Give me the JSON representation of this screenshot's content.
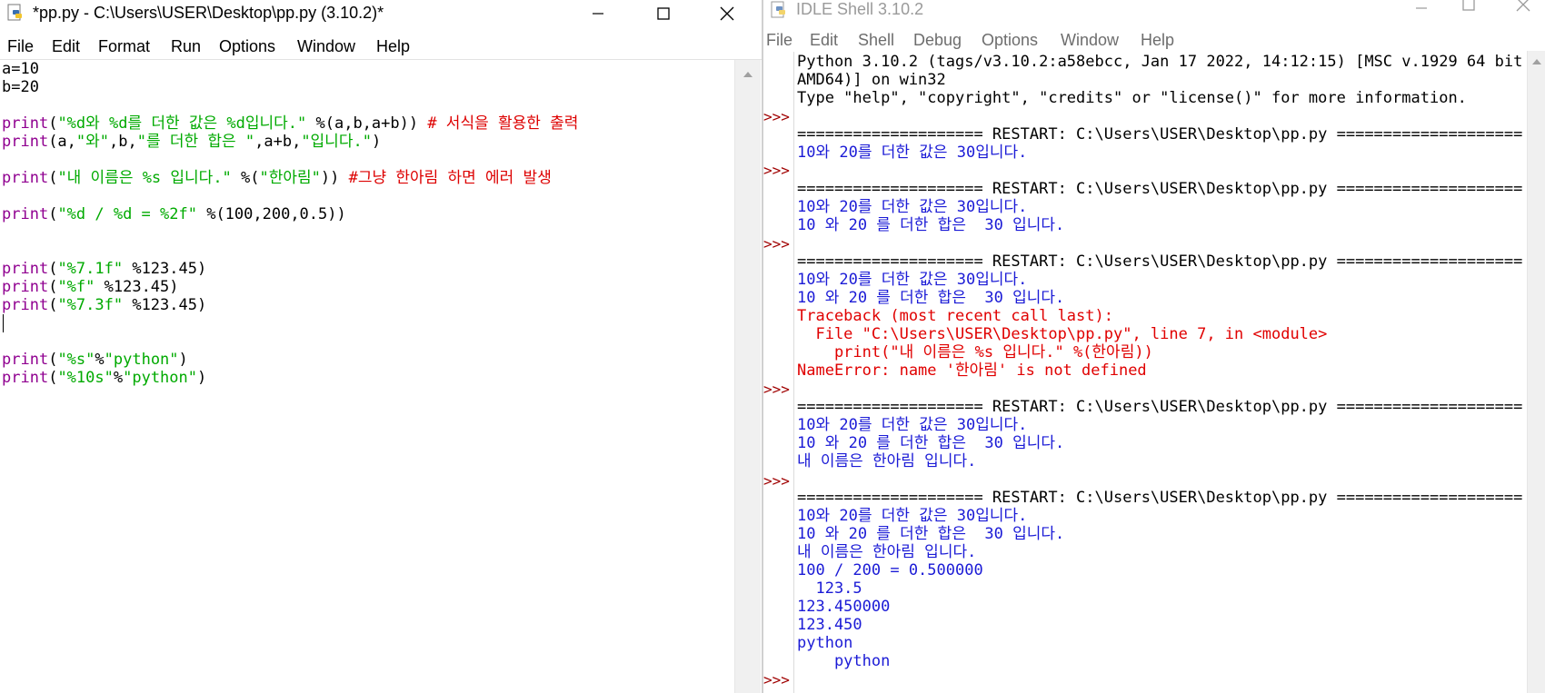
{
  "editor": {
    "title": "*pp.py - C:\\Users\\USER\\Desktop\\pp.py (3.10.2)*",
    "menu": [
      "File",
      "Edit",
      "Format",
      "Run",
      "Options",
      "Window",
      "Help"
    ],
    "code": {
      "l1": "a=10",
      "l2": "b=20",
      "l3_str": "\"%d와 %d를 더한 값은 %d입니다.\"",
      "l3_args": " %(a,b,a+b)) ",
      "l3_comment": "# 서식을 활용한 출력",
      "l4_a": "(a,",
      "l4_s1": "\"와\"",
      "l4_b": ",b,",
      "l4_s2": "\"를 더한 합은 \"",
      "l4_c": ",a+b,",
      "l4_s3": "\"입니다.\"",
      "l4_d": ")",
      "l5_str": "\"내 이름은 %s 입니다.\"",
      "l5_mid": " %(",
      "l5_str2": "\"한아림\"",
      "l5_end": ")) ",
      "l5_comment": "#그냥 한아림 하면 에러 발생",
      "l6_str": "\"%d / %d = %2f\"",
      "l6_args": " %(100,200,0.5))",
      "l7_str": "\"%7.1f\"",
      "l7_args": " %123.45)",
      "l8_str": "\"%f\"",
      "l8_args": " %123.45)",
      "l9_str": "\"%7.3f\"",
      "l9_args": " %123.45)",
      "l10_str": "\"%s\"",
      "l10_mid": "%",
      "l10_str2": "\"python\"",
      "l10_end": ")",
      "l11_str": "\"%10s\"",
      "l11_mid": "%",
      "l11_str2": "\"python\"",
      "l11_end": ")",
      "kw_print": "print",
      "paren": "("
    }
  },
  "shell": {
    "title": "IDLE Shell 3.10.2",
    "menu": [
      "File",
      "Edit",
      "Shell",
      "Debug",
      "Options",
      "Window",
      "Help"
    ],
    "prompt": ">>>",
    "banner1": "Python 3.10.2 (tags/v3.10.2:a58ebcc, Jan 17 2022, 14:12:15) [MSC v.1929 64 bit (",
    "banner2": "AMD64)] on win32",
    "banner3": "Type \"help\", \"copyright\", \"credits\" or \"license()\" for more information.",
    "restart": "==================== RESTART: C:\\Users\\USER\\Desktop\\pp.py ====================",
    "o_sum": "10와 20를 더한 값은 30입니다.",
    "o_sum2": "10 와 20 를 더한 합은  30 입니다.",
    "tb1": "Traceback (most recent call last):",
    "tb2": "  File \"C:\\Users\\USER\\Desktop\\pp.py\", line 7, in <module>",
    "tb3": "    print(\"내 이름은 %s 입니다.\" %(한아림))",
    "tb4": "NameError: name '한아림' is not defined",
    "o_name": "내 이름은 한아림 입니다.",
    "o_div": "100 / 200 = 0.500000",
    "o_f1": "  123.5",
    "o_f2": "123.450000",
    "o_f3": "123.450",
    "o_s1": "python",
    "o_s2": "    python"
  }
}
